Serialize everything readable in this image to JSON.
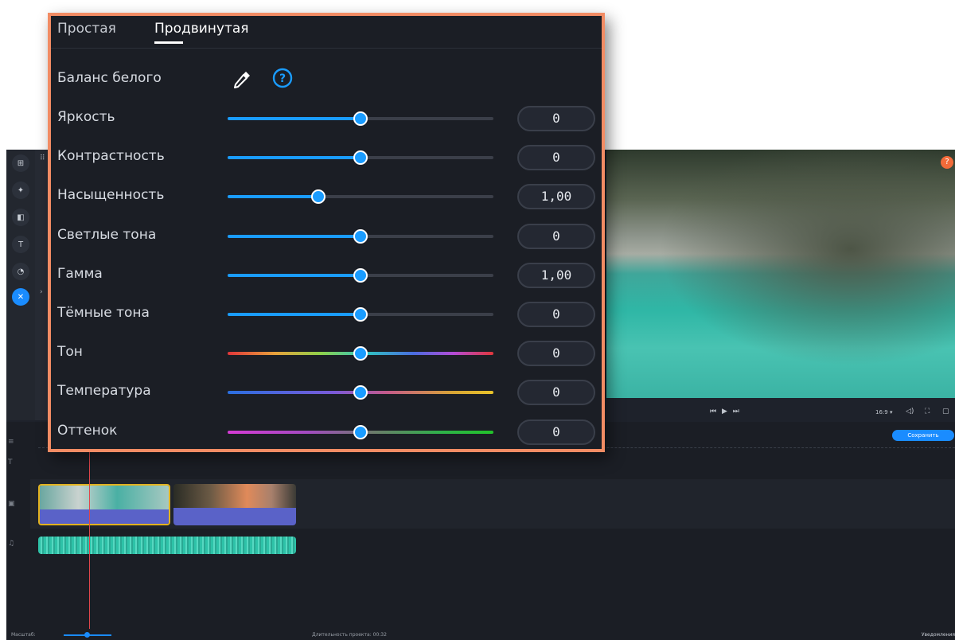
{
  "panel": {
    "tabs": [
      {
        "label": "Простая",
        "active": false
      },
      {
        "label": "Продвинутая",
        "active": true
      }
    ],
    "white_balance": {
      "label": "Баланс белого",
      "eyedropper_icon": "eyedropper-icon",
      "help_icon": "help-icon",
      "help_glyph": "?"
    },
    "sliders": [
      {
        "label": "Яркость",
        "value": "0",
        "position": 0.5,
        "track": "blue"
      },
      {
        "label": "Контрастность",
        "value": "0",
        "position": 0.5,
        "track": "blue"
      },
      {
        "label": "Насыщенность",
        "value": "1,00",
        "position": 0.34,
        "track": "blue"
      },
      {
        "label": "Светлые тона",
        "value": "0",
        "position": 0.5,
        "track": "blue"
      },
      {
        "label": "Гамма",
        "value": "1,00",
        "position": 0.5,
        "track": "blue"
      },
      {
        "label": "Тёмные тона",
        "value": "0",
        "position": 0.5,
        "track": "blue"
      },
      {
        "label": "Тон",
        "value": "0",
        "position": 0.5,
        "track": "hue"
      },
      {
        "label": "Температура",
        "value": "0",
        "position": 0.5,
        "track": "temperature"
      },
      {
        "label": "Оттенок",
        "value": "0",
        "position": 0.5,
        "track": "tint"
      }
    ]
  },
  "editor": {
    "preview_help_glyph": "?",
    "player_controls": "⏮ ▶ ⏭",
    "aspect_ratio": "16:9 ▾",
    "save_label": "Сохранить",
    "status": {
      "scale_label": "Масштаб:",
      "duration_label": "Длительность проекта: 00:32",
      "notifications_label": "Уведомления"
    }
  },
  "colors": {
    "accent": "#1a9cff",
    "panel_border": "#f28c64",
    "panel_bg": "#1b1e25",
    "track_fill": "#1a9cff",
    "track_rest": "#3b3f49"
  }
}
